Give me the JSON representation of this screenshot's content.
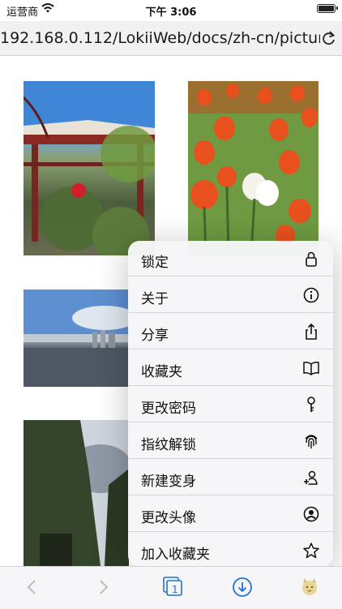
{
  "status": {
    "carrier": "运营商",
    "time": "下午 3:06"
  },
  "browser": {
    "url": "192.168.0.112/LokiiWeb/docs/zh-cn/picture.l",
    "tab_count": "1"
  },
  "menu": {
    "items": [
      {
        "label": "锁定",
        "icon": "lock-icon"
      },
      {
        "label": "关于",
        "icon": "info-icon"
      },
      {
        "label": "分享",
        "icon": "share-icon"
      },
      {
        "label": "收藏夹",
        "icon": "book-icon"
      },
      {
        "label": "更改密码",
        "icon": "key-icon"
      },
      {
        "label": "指纹解锁",
        "icon": "fingerprint-icon"
      },
      {
        "label": "新建变身",
        "icon": "add-person-icon"
      },
      {
        "label": "更改头像",
        "icon": "person-circle-icon"
      },
      {
        "label": "加入收藏夹",
        "icon": "star-icon"
      }
    ]
  },
  "colors": {
    "accent": "#1e72d8",
    "tulip": "#e8511d"
  }
}
